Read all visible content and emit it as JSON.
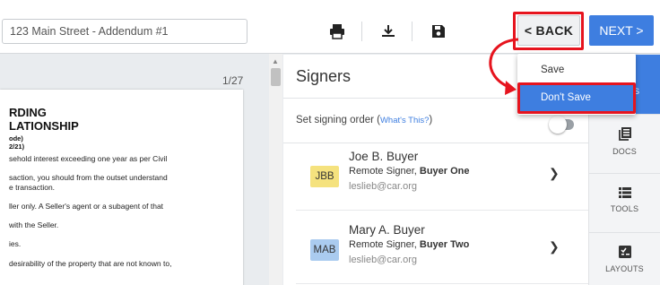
{
  "toolbar": {
    "doc_name": "123 Main Street - Addendum #1",
    "print_icon": "print-icon",
    "download_icon": "download-icon",
    "save_icon": "save-icon",
    "back_label": "< BACK",
    "next_label": "NEXT >"
  },
  "back_menu": {
    "items": [
      "Save",
      "Don't Save"
    ]
  },
  "document": {
    "page_counter": "1/27",
    "heading_line1": "RDING",
    "heading_line2": "LATIONSHIP",
    "sub1": "ode)",
    "sub2": "2/21)",
    "lines": [
      "sehold interest exceeding one year as per Civil",
      "saction, you should from the outset understand",
      "e transaction.",
      "ller only. A Seller's agent or a subagent of that",
      "with the Seller.",
      "ies.",
      "desirability of the property that are not known to,"
    ]
  },
  "signers": {
    "title": "Signers",
    "order_text": "Set signing order (",
    "order_link": "What's This?",
    "order_close": ")",
    "list": [
      {
        "initials": "JBB",
        "name": "Joe B. Buyer",
        "role_prefix": "Remote Signer, ",
        "role_bold": "Buyer One",
        "email": "leslieb@car.org",
        "avatar_color": "#f5e27e"
      },
      {
        "initials": "MAB",
        "name": "Mary A. Buyer",
        "role_prefix": "Remote Signer, ",
        "role_bold": "Buyer Two",
        "email": "leslieb@car.org",
        "avatar_color": "#aacbef"
      }
    ]
  },
  "rail": {
    "active_label": "S",
    "items": [
      {
        "icon": "docs-icon",
        "label": "DOCS"
      },
      {
        "icon": "tools-icon",
        "label": "TOOLS"
      },
      {
        "icon": "layouts-icon",
        "label": "LAYOUTS"
      }
    ]
  },
  "colors": {
    "accent": "#3e7ee0",
    "highlight": "#e6141e"
  }
}
